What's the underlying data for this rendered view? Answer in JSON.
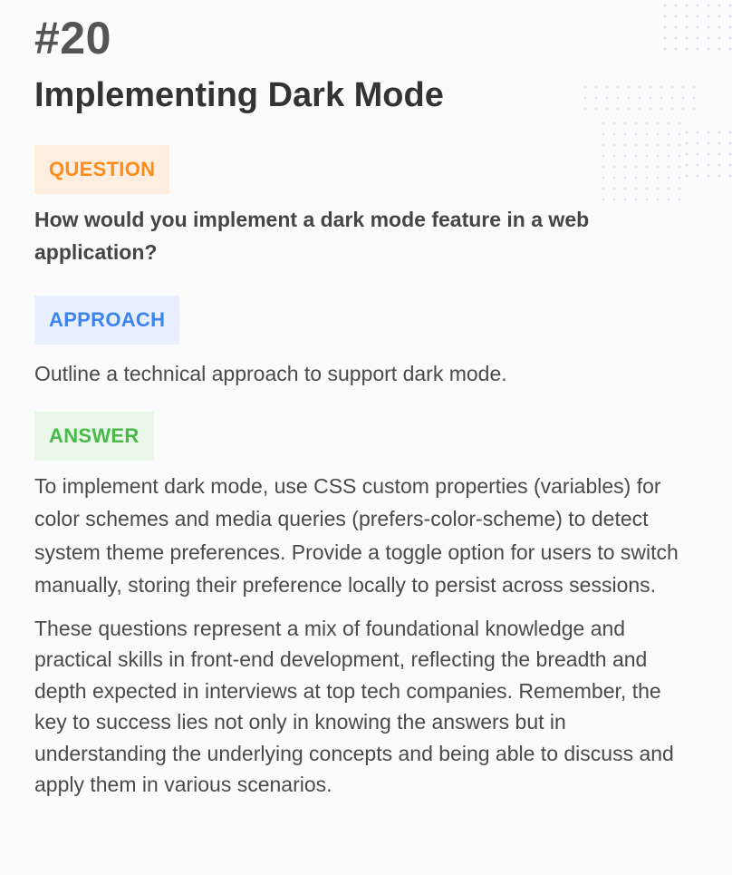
{
  "card": {
    "number": "#20",
    "title": "Implementing Dark Mode",
    "question": {
      "label": "QUESTION",
      "text": "How would you implement a dark mode feature in a web application?"
    },
    "approach": {
      "label": "APPROACH",
      "text": "Outline a technical approach to support dark mode."
    },
    "answer": {
      "label": "ANSWER",
      "text": "To implement dark mode, use CSS custom properties (variables) for color schemes and media queries (prefers-color-scheme) to detect system theme preferences. Provide a toggle option for users to switch manually, storing their preference locally to persist across sessions.",
      "summary": "These questions represent a mix of foundational knowledge and practical skills in front-end development, reflecting the breadth and depth expected in interviews at top tech companies. Remember, the key to success lies not only in knowing the answers but in understanding the underlying concepts and being able to discuss and apply them in various scenarios."
    }
  },
  "colors": {
    "question_accent": "#ff8c1a",
    "question_bg": "#fdeee0",
    "approach_accent": "#3c84ee",
    "approach_bg": "#e8efff",
    "answer_accent": "#4ab84a",
    "answer_bg": "#e8f7e7"
  },
  "decoration": {
    "icon": "dot-pattern-icon"
  }
}
